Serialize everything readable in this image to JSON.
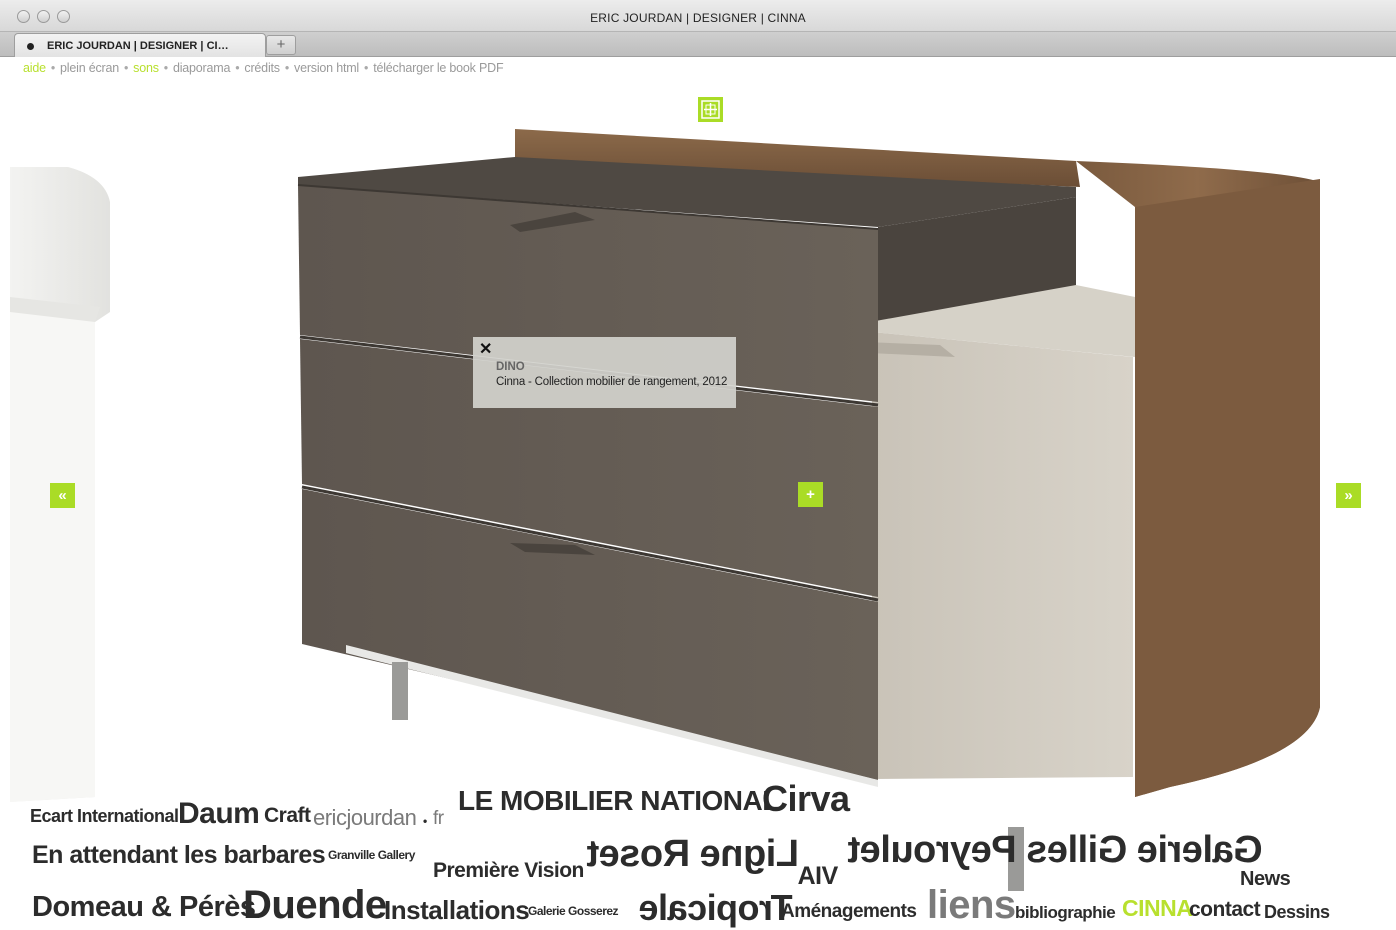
{
  "window": {
    "title": "ERIC JOURDAN | DESIGNER | CINNA",
    "tab_label": "ERIC JOURDAN | DESIGNER | CI…",
    "new_tab": "+"
  },
  "menu": {
    "items": [
      "aide",
      "plein écran",
      "sons",
      "diaporama",
      "crédits",
      "version html",
      "télécharger le book PDF"
    ],
    "separator": "•",
    "highlighted": [
      "aide",
      "sons"
    ]
  },
  "colors": {
    "accent": "#aadc26",
    "text_dark": "#2c2c2c",
    "menu_text": "#9a9a9a"
  },
  "controls": {
    "prev_icon": "«",
    "next_icon": "»",
    "plus_icon": "+",
    "grid_icon": "grid-plus-icon"
  },
  "info": {
    "close": "✕",
    "title": "DINO",
    "description": "Cinna - Collection mobilier de rangement, 2012"
  },
  "cloud": {
    "ecart": "Ecart International",
    "daum": "Daum",
    "craft": "Craft",
    "ericjourdan": "ericjourdan",
    "fr": "fr",
    "mobilier": "LE MOBILIER NATIONAL",
    "cirva": "Cirva",
    "barbares": "En attendant les barbares",
    "granville": "Granville Gallery",
    "premiere": "Première Vision",
    "ligneroset": "Ligne Roset",
    "via": "VIA",
    "peyroulet": "Galerie Gilles Peyroulet",
    "news": "News",
    "domeau": "Domeau & Pérès",
    "duende": "Duende",
    "installations": "Installations",
    "gosserez": "Galerie Gosserez",
    "tropicale": "Tropicale",
    "amenagements": "Aménagements",
    "liens": "liens",
    "bibliographie": "bibliographie",
    "cinna": "CINNA",
    "contact": "contact",
    "dessins": "Dessins"
  }
}
